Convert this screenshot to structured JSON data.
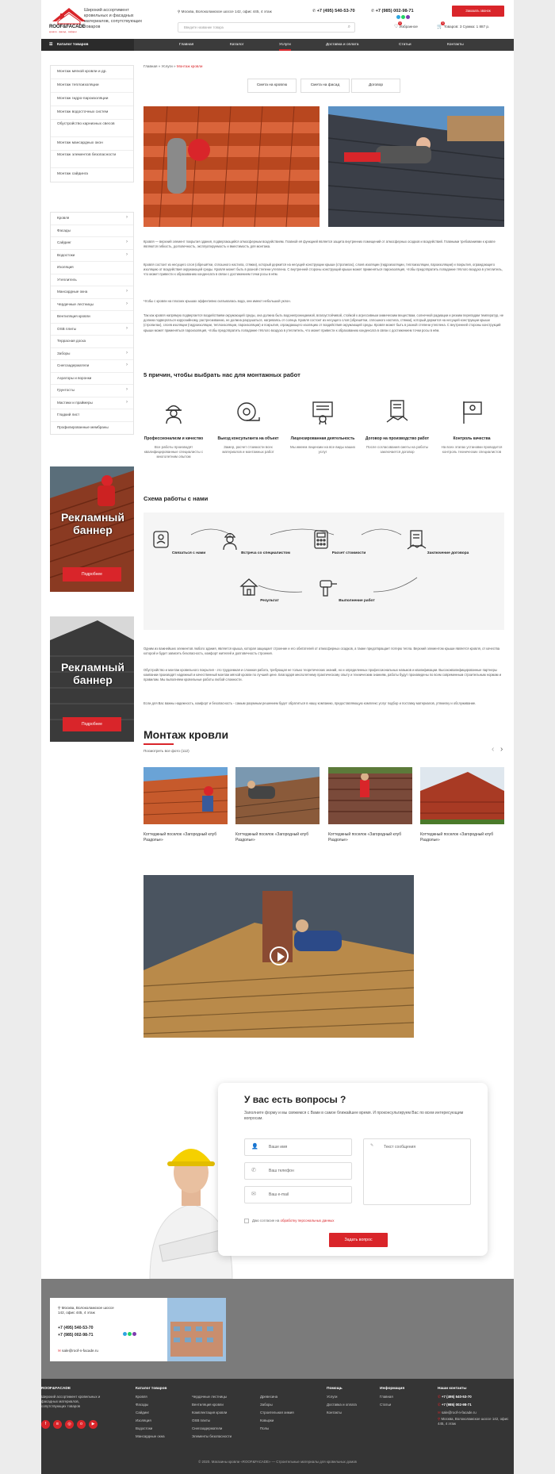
{
  "header": {
    "logo_text": "ROOF&FACADE",
    "logo_sub": "кровля · фасад · сайдинг",
    "tagline": "Широкий ассортимент кровельных и фасадных материалов, сопутствующих товаров",
    "address": "Москва, Волоколамское шоссе 142, офис 445, 4 этаж",
    "search_placeholder": "Введите название товара",
    "phone1": "+7 (495) 540-53-70",
    "phone2": "+7 (985) 002-98-71",
    "callback_label": "Заказать звонок",
    "favorites_label": "Избранное",
    "favorites_count": "0",
    "cart_label": "Товаров: 3 Суммa: 1 887 р.",
    "cart_count": "3"
  },
  "nav": {
    "catalog_label": "Каталог товаров",
    "items": [
      "Главная",
      "Каталог",
      "Услуги",
      "Доставка и оплата",
      "Статьи",
      "Контакты"
    ]
  },
  "sidebar": {
    "services": [
      "Монтаж мягкой кровли и др.",
      "Монтаж теплоизоляции",
      "Монтаж гидро-пароизоляции",
      "Монтаж водосточных систем",
      "Обустройство карнизных свесов",
      "Монтаж мансардных окон",
      "Монтаж элементов безопасности",
      "Монтаж сайдинга"
    ],
    "catalog": [
      "Кровля",
      "Фасады",
      "Сайдинг",
      "Водостоки",
      "Изоляция",
      "Утеплитель",
      "Мансардные окна",
      "Чердачные лестницы",
      "Вентиляция кровли",
      "OSB плиты",
      "Террасная доска",
      "Заборы",
      "Снегозадержатели",
      "Аэраторы и воронки",
      "Грунтосты",
      "Мастики и праймеры",
      "Гладкий лист",
      "Профилированные мембраны"
    ],
    "banner_title": "Рекламный баннер",
    "banner_button": "Подробнее"
  },
  "breadcrumbs": {
    "home": "Главная",
    "sep": "»",
    "section": "Услуги",
    "current": "Монтаж кровли"
  },
  "tabs": [
    "Смета на кровлю",
    "Смета на фасад",
    "Договор"
  ],
  "paragraphs": {
    "p1": "Кровля — верхний элемент покрытия здания, подвергающийся атмосферным воздействиям. Главной её функцией является защита внутренних помещений от атмосферных осадков и воздействий. Главными требованиями к кровле являются гибкость, долговечность, эксплуатируемость и вместимость для монтажа.",
    "p2": "Кровля состоит из несущего слоя (обрешётки, сплошного настила, стяжки), который держится на несущей конструкции крыши (стропилах), слоев изоляции (гидроизоляции, теплоизоляции, пароизоляции) и покрытия, ограждающего изоляцию от воздействия окружающей среды. Кровля может быть в разной степени утеплена. С внутренней стороны конструкций крыши может применяться пароизоляция, чтобы предотвратить попадание тёплого воздуха в утеплитель, что может привести к образованию конденсата в связи с достижением точки росы в нём.",
    "p3": "Чтобы с кровли на плоских крышах эффективно скатывалась вода, они имеют небольшой уклон.",
    "p4": "Так как кровля напрямую подвергается воздействиям окружающей среды, она должна быть водонепроницаемой, влагоустойчивой, стойкой к агрессивным химическим веществам, солнечной радиации и резким перепадам температур, не должна подвергаться коррозийному, растрескиванию, не должна разрушаться, нагреваясь от солнца. Кровля состоит из несущего слоя (обрешётки, сплошного настила, стяжки), который держится на несущей конструкции крыши (стропилах), слоев изоляции (гидроизоляции, теплоизоляции, пароизоляции) и покрытия, ограждающего изоляцию от воздействия окружающей среды. Кровля может быть в разной степени утеплена. С внутренней стороны конструкций крыши может применяться пароизоляция, чтобы предотвратить попадание тёплого воздуха в утеплитель, что может привести к образованию конденсата в связи с достижением точки росы в нём.",
    "p5": "Одним из важнейших элементов любого здания, является крыша, которая защищает строение и его обитателей от атмосферных осадков, а также предотвращает потерю тепла. Верхний элементом крыши является кровля, от качества которой и будет зависеть безопасность, комфорт жителей и долговечность строения.",
    "p6": "Обустройство и монтаж кровельного покрытия - это трудоемкая и сложная работа, требующая не только теоретических знаний, но и определенных профессиональных навыков и квалификации. Высококвалифицированные партнеры компании производят надежный и качественный монтаж мягкой кровли по лучшей цене. Благодаря многолетнему практическому опыту и техническим знаниям, работы будут произведены по всем современным строительным нормам и правилам. Мы выполняем кровельные работы любой сложности.",
    "p7": "Если для Вас важны надежность, комфорт и безопасность - самым разумным решением будет обратиться в нашу компанию, предоставляющую комплекс услуг подбор и поставку материалов, утяжелку и обслуживание."
  },
  "reasons": {
    "heading": "5 причин, чтобы выбрать нас для монтажных работ",
    "items": [
      {
        "title": "Профессионализм и качество",
        "desc": "Все работы производят квалифицированные специалисты с многолетним опытом",
        "icon": "worker-helmet-icon"
      },
      {
        "title": "Выезд консультанта на объект",
        "desc": "Замер, расчет стоимости всех материалов и монтажных работ",
        "icon": "tape-measure-icon"
      },
      {
        "title": "Лицензированная деятельность",
        "desc": "Мы имеем лицензии на все виды наших услуг",
        "icon": "certificate-icon"
      },
      {
        "title": "Договор на производство работ",
        "desc": "После согласования сметы на работы заключается договор",
        "icon": "handshake-document-icon"
      },
      {
        "title": "Контроль качества",
        "desc": "На всех этапах установки проводится контроль технических специалистов",
        "icon": "quality-flag-icon"
      }
    ]
  },
  "schema": {
    "heading": "Схема работы с нами",
    "steps": [
      "Связаться с нами",
      "Встреча со специалистом",
      "Расчет стоимости",
      "Заключение договора",
      "Выполнение работ",
      "Результат"
    ]
  },
  "gallery": {
    "heading": "Монтаж кровли",
    "all_photos": "Посмотреть все фото (112)",
    "items": [
      "Коттеджный поселок «Загородный клуб Раздолье»",
      "Коттеджный поселок «Загородный клуб Раздолье»",
      "Коттеджный поселок «Загородный клуб Раздолье»",
      "Коттеджный поселок «Загородный клуб Раздолье»"
    ]
  },
  "form": {
    "heading": "У вас есть вопросы ?",
    "text": "Заполните форму и мы свяжемся с Вами в самое ближайшее время. И проконсультируем Вас по всем интересующим вопросам.",
    "name_placeholder": "Ваше имя",
    "phone_placeholder": "Ваш телефон",
    "email_placeholder": "Ваш e-mail",
    "message_placeholder": "Текст сообщения",
    "agree_text": "Даю согласие на",
    "agree_link": "обработку персональных данных",
    "submit_label": "Задать вопрос"
  },
  "contact_card": {
    "address": "Москва, Волоколамское шоссе 142, офис 445, 4 этаж",
    "phone1": "+7 (495) 540-53-70",
    "phone2": "+7 (985) 002-98-71",
    "email": "sale@roof-n-facade.ru"
  },
  "footer": {
    "brand": "ROOF&FACADE",
    "about": "Широкий ассортимент кровельных и фасадных материалов, сопутствующих товаров",
    "catalog_heading": "Каталог товаров",
    "catalog_col1": [
      "Кровля",
      "Фасады",
      "Сайдинг",
      "Изоляция",
      "Водостоки",
      "Мансардные окна"
    ],
    "catalog_col2": [
      "Чердачные лестницы",
      "Вентиляция кровли",
      "Комплектация кровли",
      "OSB плиты",
      "Снегозадержатели",
      "Элементы безопасности"
    ],
    "catalog_col3": [
      "Древесина",
      "Заборы",
      "Строительная химия",
      "Ковырки",
      "Полы"
    ],
    "help_heading": "Помощь",
    "help": [
      "Услуги",
      "Доставка и оплата",
      "Контакты"
    ],
    "info_heading": "Информация",
    "info": [
      "Главная",
      "Статьи"
    ],
    "contacts_heading": "Наши контакты",
    "phone1": "+7 (495) 540-53-70",
    "phone2": "+7 (985) 002-98-71",
    "email": "sale@roof-n-facade.ru",
    "address": "Москва, Волоколамское шоссе 142, офис 445, 4 этаж",
    "copyright": "© 2020. Магазины кровли «ROOF&FACADE» — Строительные материалы для кровельных домов"
  },
  "colors": {
    "accent": "#d9252a",
    "nav": "#3b3b3b",
    "footer": "#353535"
  }
}
